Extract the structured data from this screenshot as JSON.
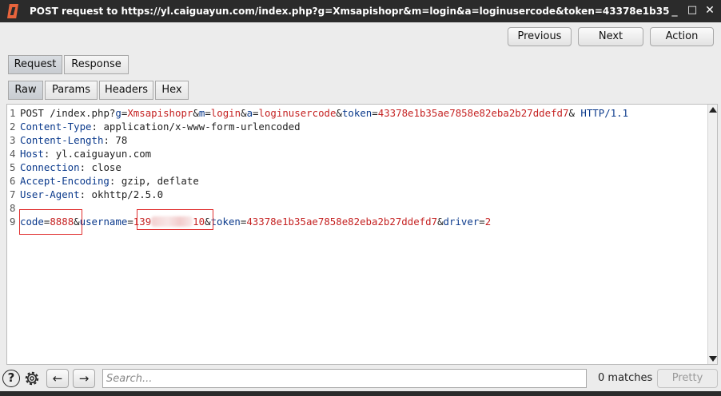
{
  "window": {
    "title": "POST request to https://yl.caiguayun.com/index.php?g=Xmsapishopr&m=login&a=loginusercode&token=43378e1b35ae7858e82eba2b27ddefd7&",
    "minimize": "_",
    "maximize": "□",
    "close": "✕"
  },
  "toolbar": {
    "previous_label": "Previous",
    "next_label": "Next",
    "action_label": "Action"
  },
  "main_tabs": [
    {
      "label": "Request",
      "selected": true
    },
    {
      "label": "Response",
      "selected": false
    }
  ],
  "sub_tabs": [
    {
      "label": "Raw",
      "selected": true
    },
    {
      "label": "Params",
      "selected": false
    },
    {
      "label": "Headers",
      "selected": false
    },
    {
      "label": "Hex",
      "selected": false
    }
  ],
  "request": {
    "line1": {
      "num": "1",
      "method": "POST",
      "path": " /index.php?",
      "p1k": "g",
      "p1v": "Xmsapishopr",
      "p2k": "m",
      "p2v": "login",
      "p3k": "a",
      "p3v": "loginusercode",
      "p4k": "token",
      "p4v": "43378e1b35ae7858e82eba2b27ddefd7",
      "amp": "&",
      "eq": "=",
      "proto": "HTTP/1.1"
    },
    "headers": [
      {
        "num": "2",
        "name": "Content-Type",
        "value": "application/x-www-form-urlencoded"
      },
      {
        "num": "3",
        "name": "Content-Length",
        "value": "78"
      },
      {
        "num": "4",
        "name": "Host",
        "value": "yl.caiguayun.com"
      },
      {
        "num": "5",
        "name": "Connection",
        "value": "close"
      },
      {
        "num": "6",
        "name": "Accept-Encoding",
        "value": "gzip, deflate"
      },
      {
        "num": "7",
        "name": "User-Agent",
        "value": "okhttp/2.5.0"
      }
    ],
    "blank_num": "8",
    "body": {
      "num": "9",
      "b1k": "code",
      "b1v": "8888",
      "b2k": "username",
      "b2v_start": "139",
      "b2v_end": "10",
      "b3k": "token",
      "b3v": "43378e1b35ae7858e82eba2b27ddefd7",
      "b4k": "driver",
      "b4v": "2"
    }
  },
  "footer": {
    "help_icon": "?",
    "search_placeholder": "Search...",
    "matches": "0 matches",
    "pretty_label": "Pretty"
  }
}
